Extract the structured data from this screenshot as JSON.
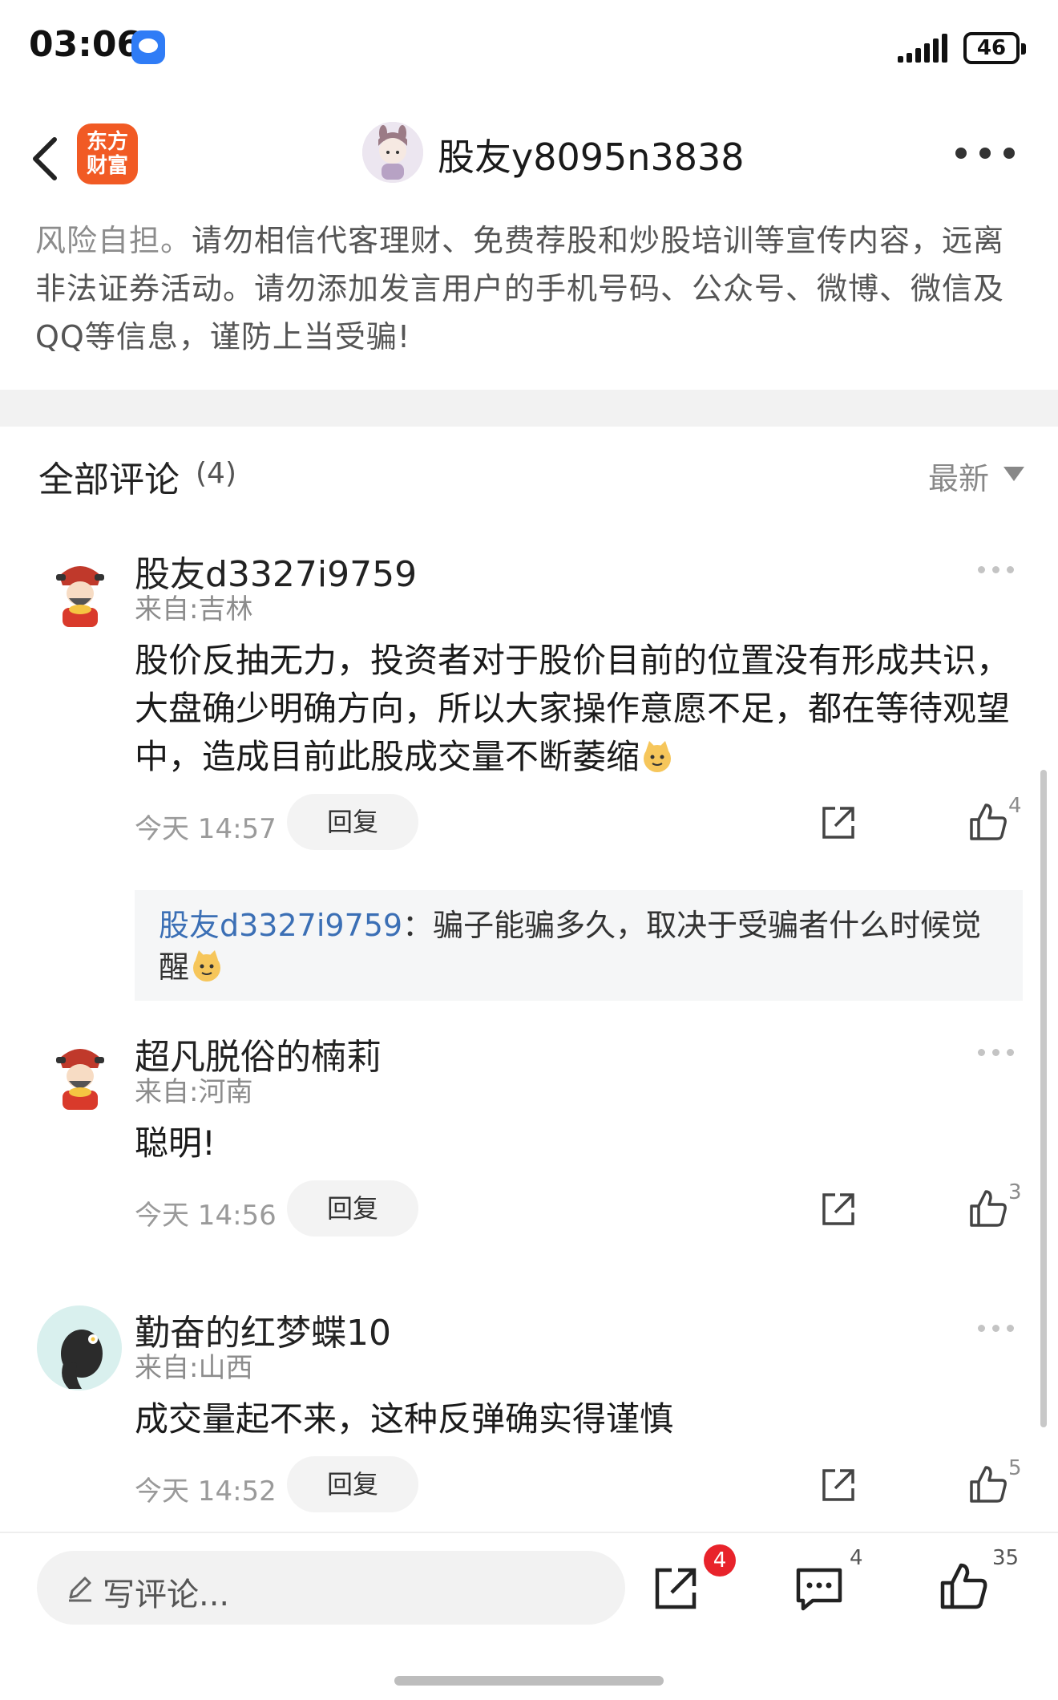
{
  "status_bar": {
    "time": "03:06",
    "battery": "46"
  },
  "header": {
    "app_logo_text": "东方财富",
    "title": "股友y8095n3838"
  },
  "warning": {
    "lead": "风险自担。",
    "text": "请勿相信代客理财、免费荐股和炒股培训等宣传内容，远离非法证券活动。请勿添加发言用户的手机号码、公众号、微博、微信及QQ等信息，谨防上当受骗!"
  },
  "comments_header": {
    "title": "全部评论",
    "count": "(4)",
    "sort": "最新"
  },
  "comments": [
    {
      "name": "股友d3327i9759",
      "location": "来自:吉林",
      "text": "股价反抽无力，投资者对于股价目前的位置没有形成共识，大盘确少明确方向，所以大家操作意愿不足，都在等待观望中，造成目前此股成交量不断萎缩",
      "time": "今天 14:57",
      "reply": "回复",
      "likes": "4"
    },
    {
      "name": "超凡脱俗的楠莉",
      "location": "来自:河南",
      "text": "聪明!",
      "time": "今天 14:56",
      "reply": "回复",
      "likes": "3"
    },
    {
      "name": "勤奋的红梦蝶10",
      "location": "来自:山西",
      "text": "成交量起不来，这种反弹确实得谨慎",
      "time": "今天 14:52",
      "reply": "回复",
      "likes": "5"
    }
  ],
  "quoted_reply": {
    "name": "股友d3327i9759",
    "colon": "：",
    "text": "骗子能骗多久，取决于受骗者什么时候觉醒"
  },
  "bottom_bar": {
    "placeholder": "写评论...",
    "share_badge": "4",
    "comment_count": "4",
    "like_count": "35"
  },
  "colors": {
    "accent_blue": "#3b6fb5",
    "brand_orange": "#f15a24",
    "badge_red": "#e8232b"
  }
}
